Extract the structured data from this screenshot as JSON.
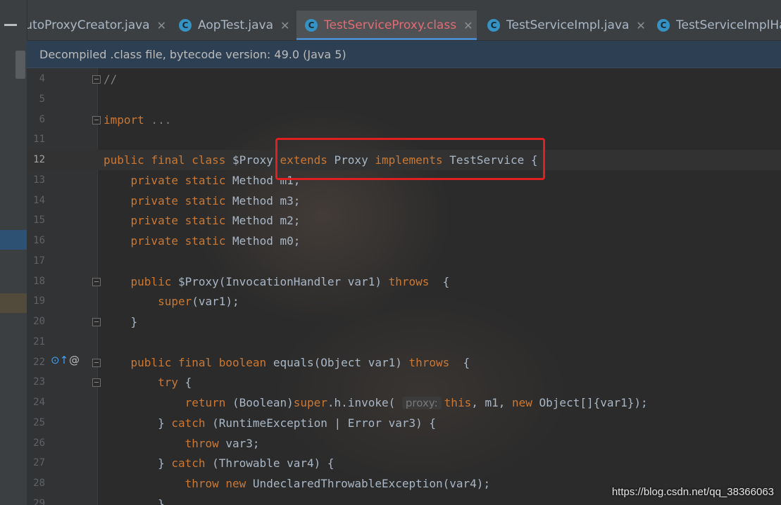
{
  "tabs": [
    {
      "label": "utoProxyCreator.java",
      "icon": "minus-icon",
      "active": false
    },
    {
      "label": "AopTest.java",
      "icon": "class-icon",
      "active": false
    },
    {
      "label": "TestServiceProxy.class",
      "icon": "class-icon",
      "active": true
    },
    {
      "label": "TestServiceImpl.java",
      "icon": "class-icon",
      "active": false
    },
    {
      "label": "TestServiceImplHa",
      "icon": "class-icon",
      "active": false
    }
  ],
  "banner": {
    "text": "Decompiled .class file, bytecode version: 49.0 (Java 5)"
  },
  "lines": [
    {
      "n": "4",
      "parts": [
        {
          "t": "//",
          "c": "cm"
        }
      ]
    },
    {
      "n": "5",
      "parts": []
    },
    {
      "n": "6",
      "parts": [
        {
          "t": "import",
          "c": "kw"
        },
        {
          "t": " ...",
          "c": "cm"
        }
      ]
    },
    {
      "n": "11",
      "parts": []
    },
    {
      "n": "12",
      "parts": [
        {
          "t": "public final class ",
          "c": "kw"
        },
        {
          "t": "$Proxy ",
          "c": ""
        },
        {
          "t": "extends ",
          "c": "kw"
        },
        {
          "t": "Proxy ",
          "c": ""
        },
        {
          "t": "implements ",
          "c": "kw"
        },
        {
          "t": "TestService ",
          "c": ""
        },
        {
          "t": "{",
          "c": ""
        }
      ]
    },
    {
      "n": "13",
      "parts": [
        {
          "t": "    private static ",
          "c": "kw"
        },
        {
          "t": "Method m1;",
          "c": ""
        }
      ]
    },
    {
      "n": "14",
      "parts": [
        {
          "t": "    private static ",
          "c": "kw"
        },
        {
          "t": "Method m3;",
          "c": ""
        }
      ]
    },
    {
      "n": "15",
      "parts": [
        {
          "t": "    private static ",
          "c": "kw"
        },
        {
          "t": "Method m2;",
          "c": ""
        }
      ]
    },
    {
      "n": "16",
      "parts": [
        {
          "t": "    private static ",
          "c": "kw"
        },
        {
          "t": "Method m0;",
          "c": ""
        }
      ]
    },
    {
      "n": "17",
      "parts": []
    },
    {
      "n": "18",
      "parts": [
        {
          "t": "    public ",
          "c": "kw"
        },
        {
          "t": "$Proxy(InvocationHandler var1) ",
          "c": ""
        },
        {
          "t": "throws",
          "c": "kw"
        },
        {
          "t": "  {",
          "c": ""
        }
      ]
    },
    {
      "n": "19",
      "parts": [
        {
          "t": "        super",
          "c": "kw"
        },
        {
          "t": "(var1);",
          "c": ""
        }
      ]
    },
    {
      "n": "20",
      "parts": [
        {
          "t": "    }",
          "c": ""
        }
      ]
    },
    {
      "n": "21",
      "parts": []
    },
    {
      "n": "22",
      "parts": [
        {
          "t": "    public final boolean ",
          "c": "kw"
        },
        {
          "t": "equals(Object var1) ",
          "c": ""
        },
        {
          "t": "throws",
          "c": "kw"
        },
        {
          "t": "  {",
          "c": ""
        }
      ]
    },
    {
      "n": "23",
      "parts": [
        {
          "t": "        try ",
          "c": "kw"
        },
        {
          "t": "{",
          "c": ""
        }
      ]
    },
    {
      "n": "24",
      "parts": [
        {
          "t": "            return ",
          "c": "kw"
        },
        {
          "t": "(Boolean)",
          "c": ""
        },
        {
          "t": "super",
          "c": "kw"
        },
        {
          "t": ".h.invoke( ",
          "c": ""
        },
        {
          "t": "proxy:",
          "c": "hint"
        },
        {
          "t": "this",
          "c": "kw"
        },
        {
          "t": ", m1, ",
          "c": ""
        },
        {
          "t": "new ",
          "c": "kw"
        },
        {
          "t": "Object[]{var1});",
          "c": ""
        }
      ]
    },
    {
      "n": "25",
      "parts": [
        {
          "t": "        } ",
          "c": ""
        },
        {
          "t": "catch ",
          "c": "kw"
        },
        {
          "t": "(RuntimeException | Error var3) {",
          "c": ""
        }
      ]
    },
    {
      "n": "26",
      "parts": [
        {
          "t": "            throw ",
          "c": "kw"
        },
        {
          "t": "var3;",
          "c": ""
        }
      ]
    },
    {
      "n": "27",
      "parts": [
        {
          "t": "        } ",
          "c": ""
        },
        {
          "t": "catch ",
          "c": "kw"
        },
        {
          "t": "(Throwable var4) {",
          "c": ""
        }
      ]
    },
    {
      "n": "28",
      "parts": [
        {
          "t": "            throw new ",
          "c": "kw"
        },
        {
          "t": "UndeclaredThrowableException(var4);",
          "c": ""
        }
      ]
    },
    {
      "n": "29",
      "parts": [
        {
          "t": "        }",
          "c": ""
        }
      ]
    }
  ],
  "gutter_icons": {
    "line22": [
      "override-icon",
      "at-icon"
    ]
  },
  "watermark": "https://blog.csdn.net/qq_38366063"
}
